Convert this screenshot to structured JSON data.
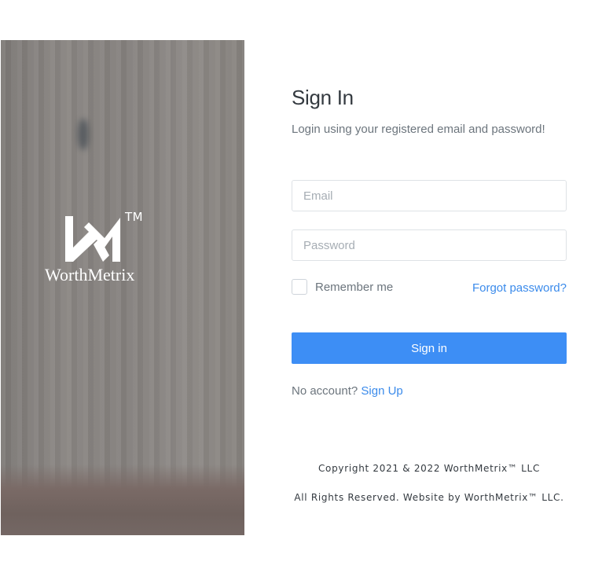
{
  "brand": {
    "name": "WorthMetrix",
    "trademark": "TM"
  },
  "signin": {
    "title": "Sign In",
    "subtitle": "Login using your registered email and password!",
    "email_placeholder": "Email",
    "password_placeholder": "Password",
    "remember_label": "Remember me",
    "forgot_label": "Forgot password?",
    "button_label": "Sign in",
    "no_account_text": "No account?",
    "signup_label": "Sign Up"
  },
  "footer": {
    "copyright": "Copyright 2021 & 2022 WorthMetrix™ LLC",
    "rights": "All Rights Reserved. Website by WorthMetrix™ LLC."
  },
  "colors": {
    "primary": "#3d8ef5",
    "link": "#3b8beb",
    "heading": "#343a40",
    "muted": "#6c757d"
  },
  "icons": {
    "logo": "worthmetrix-logo-icon"
  }
}
